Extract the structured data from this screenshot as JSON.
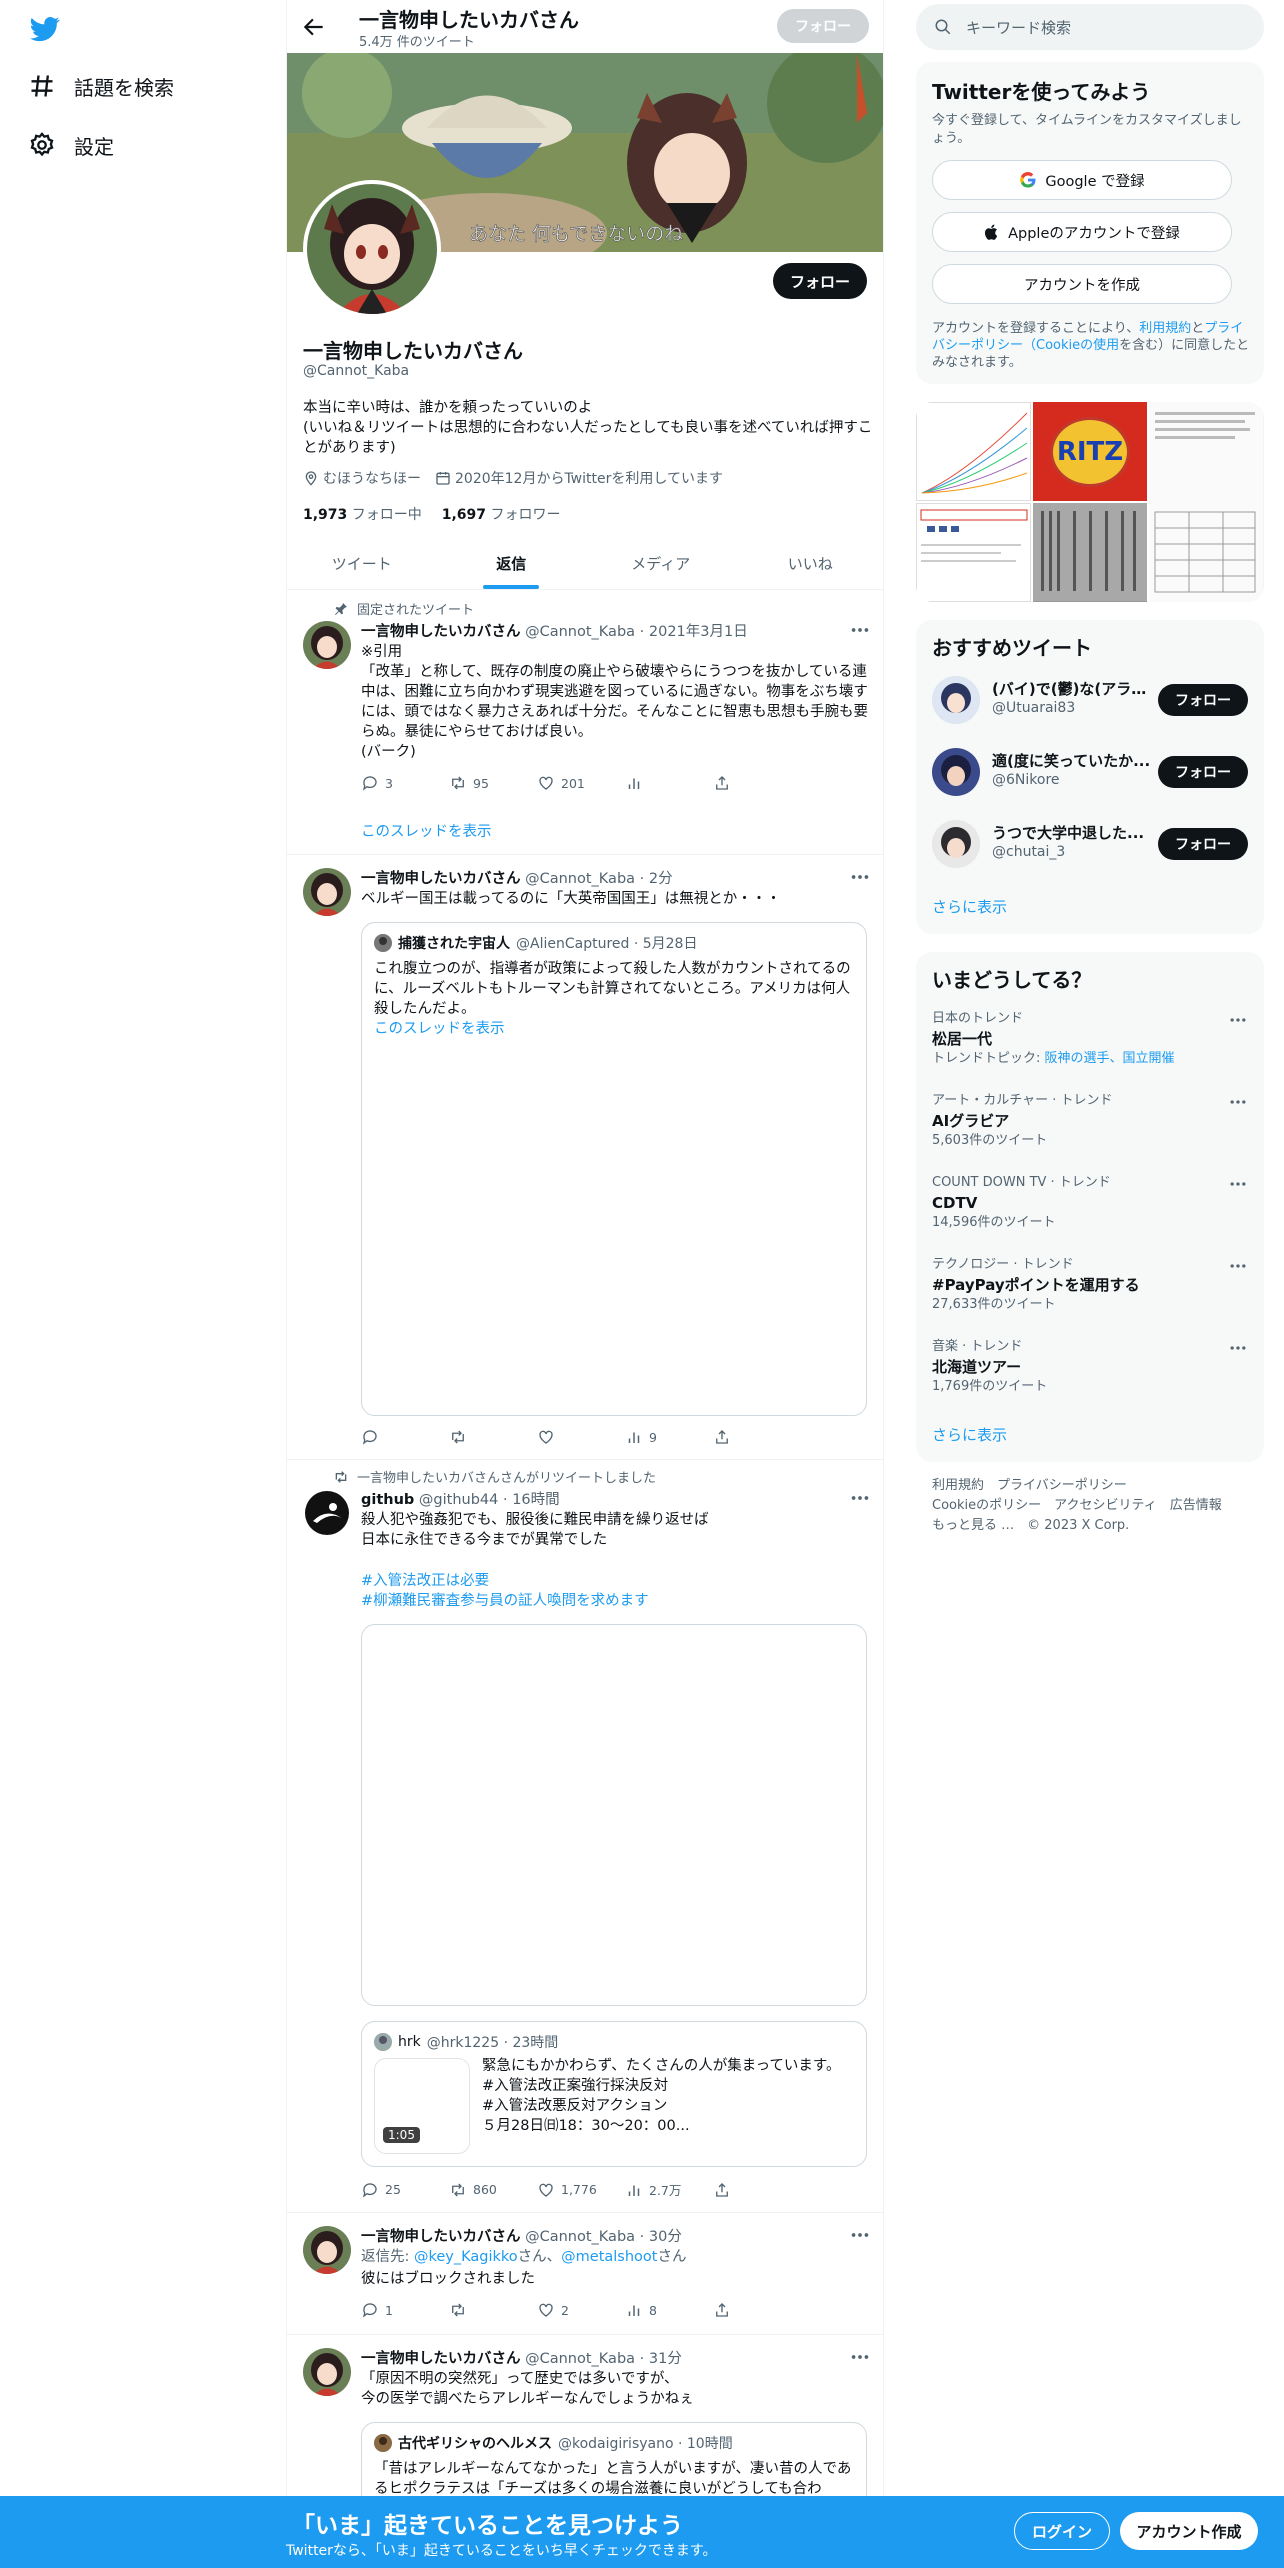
{
  "nav": {
    "explore_label": "話題を検索",
    "settings_label": "設定"
  },
  "profile": {
    "top_name": "一言物申したいカバさん",
    "tweet_count": "5.4万 件のツイート",
    "top_follow": "フォロー",
    "banner_caption": "あなた 何もできないのね",
    "follow": "フォロー",
    "name": "一言物申したいカバさん",
    "handle": "@Cannot_Kaba",
    "bio": "本当に辛い時は、誰かを頼ったっていいのよ\n(いいね＆リツイートは思想的に合わない人だったとしても良い事を述べていれば押すことがあります)",
    "location": "むほうなちほー",
    "joined": "2020年12月からTwitterを利用しています",
    "following_count": "1,973",
    "following_label": "フォロー中",
    "followers_count": "1,697",
    "followers_label": "フォロワー"
  },
  "tabs": [
    "ツイート",
    "返信",
    "メディア",
    "いいね"
  ],
  "tweets": [
    {
      "social": "固定されたツイート",
      "name": "一言物申したいカバさん",
      "meta": "@Cannot_Kaba · 2021年3月1日",
      "text": "※引用\n「改革」と称して、既存の制度の廃止やら破壊やらにうつつを抜かしている連中は、困難に立ち向かわず現実逃避を図っているに過ぎない。物事をぶち壊すには、頭ではなく暴力さえあれば十分だ。そんなことに智恵も思想も手腕も要らぬ。暴徒にやらせておけば良い。\n(バーク)",
      "replies": "3",
      "retweets": "95",
      "likes": "201",
      "show_thread": "このスレッドを表示"
    },
    {
      "name": "一言物申したいカバさん",
      "meta": "@Cannot_Kaba · 2分",
      "text": "ベルギー国王は載ってるのに「大英帝国国王」は無視とか・・・",
      "quote_name": "捕獲された宇宙人",
      "quote_meta": "@AlienCaptured · 5月28日",
      "quote_text": "これ腹立つのが、指導者が政策によって殺した人数がカウントされてるのに、ルーズベルトもトルーマンも計算されてないところ。アメリカは何人殺したんだよ。",
      "quote_thread": "このスレッドを表示",
      "views": "9"
    },
    {
      "social": "一言物申したいカバさんさんがリツイートしました",
      "name": "github",
      "meta": "@github44 · 16時間",
      "text": "殺人犯や強姦犯でも、服役後に難民申請を繰り返せば\n日本に永住できる今までが異常でした",
      "hashtag1": "#入管法改正は必要",
      "hashtag2": "#柳瀬難民審査参与員の証人喚問を求めます",
      "quote_name": "hrk",
      "quote_meta": "@hrk1225 · 23時間",
      "quote_text": "緊急にもかかわらず、たくさんの人が集まっています。\n#入管法改正案強行採決反対\n#入管法改悪反対アクション\n５月28日㈰18：30～20：00...",
      "video_time": "1:05",
      "replies": "25",
      "retweets": "860",
      "likes": "1,776",
      "views": "2.7万"
    },
    {
      "name": "一言物申したいカバさん",
      "meta": "@Cannot_Kaba · 30分",
      "reply_prefix": "返信先: ",
      "reply_to1": "@key_Kagikko",
      "reply_mid": "さん、",
      "reply_to2": "@metalshoot",
      "reply_suffix": "さん",
      "text": "彼にはブロックされました",
      "replies": "1",
      "likes": "2",
      "views": "8"
    },
    {
      "name": "一言物申したいカバさん",
      "meta": "@Cannot_Kaba · 31分",
      "text": "「原因不明の突然死」って歴史では多いですが、\n今の医学で調べたらアレルギーなんでしょうかねぇ",
      "quote_name": "古代ギリシャのヘルメス",
      "quote_meta": "@kodaigirisyano · 10時間",
      "quote_text": "「昔はアレルギーなんてなかった」と言う人がいますが、凄い昔の人であるヒポクラテスは「チーズは多くの場合滋養に良いがどうしても合わ"
    }
  ],
  "right": {
    "search_placeholder": "キーワード検索",
    "signup_title": "Twitterを使ってみよう",
    "signup_sub": "今すぐ登録して、タイムラインをカスタマイズしましょう。",
    "google_btn": "Google で登録",
    "apple_btn": "Appleのアカウントで登録",
    "create_btn": "アカウントを作成",
    "terms_1": "アカウントを登録することにより、",
    "terms_link1": "利用規約",
    "terms_2": "と",
    "terms_link2": "プライバシーポリシー（Cookieの使用",
    "terms_3": "を含む）に同意したとみなされます。",
    "media_ritz": "RITZ",
    "wtf_title": "おすすめツイート",
    "wtf": [
      {
        "name": "(バイ)で(鬱)な(アラ)...",
        "handle": "@Utuarai83",
        "btn": "フォロー"
      },
      {
        "name": "適(度に笑っていたか...",
        "handle": "@6Nikore",
        "btn": "フォロー"
      },
      {
        "name": "うつで大学中退した...",
        "handle": "@chutai_3",
        "btn": "フォロー"
      }
    ],
    "wtf_more": "さらに表示",
    "trends_title": "いまどうしてる？",
    "trends": [
      {
        "ctx": "日本のトレンド",
        "name": "松居一代",
        "sub": "トレンドトピック: ",
        "sub_link": "阪神の選手、国立開催"
      },
      {
        "ctx": "アート・カルチャー · トレンド",
        "name": "AIグラビア",
        "sub": "5,603件のツイート"
      },
      {
        "ctx": "COUNT DOWN TV · トレンド",
        "name": "CDTV",
        "sub": "14,596件のツイート"
      },
      {
        "ctx": "テクノロジー · トレンド",
        "name": "#PayPayポイントを運用する",
        "sub": "27,633件のツイート"
      },
      {
        "ctx": "音楽 · トレンド",
        "name": "北海道ツアー",
        "sub": "1,769件のツイート"
      }
    ],
    "trends_more": "さらに表示",
    "footer": {
      "terms": "利用規約",
      "privacy": "プライバシーポリシー",
      "cookie": "Cookieのポリシー",
      "access": "アクセシビリティ",
      "ads": "広告情報",
      "more": "もっと見る …",
      "copy": "© 2023 X Corp."
    }
  },
  "bottom": {
    "title": "「いま」起きていることを見つけよう",
    "sub": "Twitterなら、「いま」起きていることをいち早くチェックできます。",
    "login": "ログイン",
    "signup": "アカウント作成"
  },
  "colors": {
    "accent": "#1d9bf0",
    "text": "#0f1419",
    "muted": "#536471"
  }
}
